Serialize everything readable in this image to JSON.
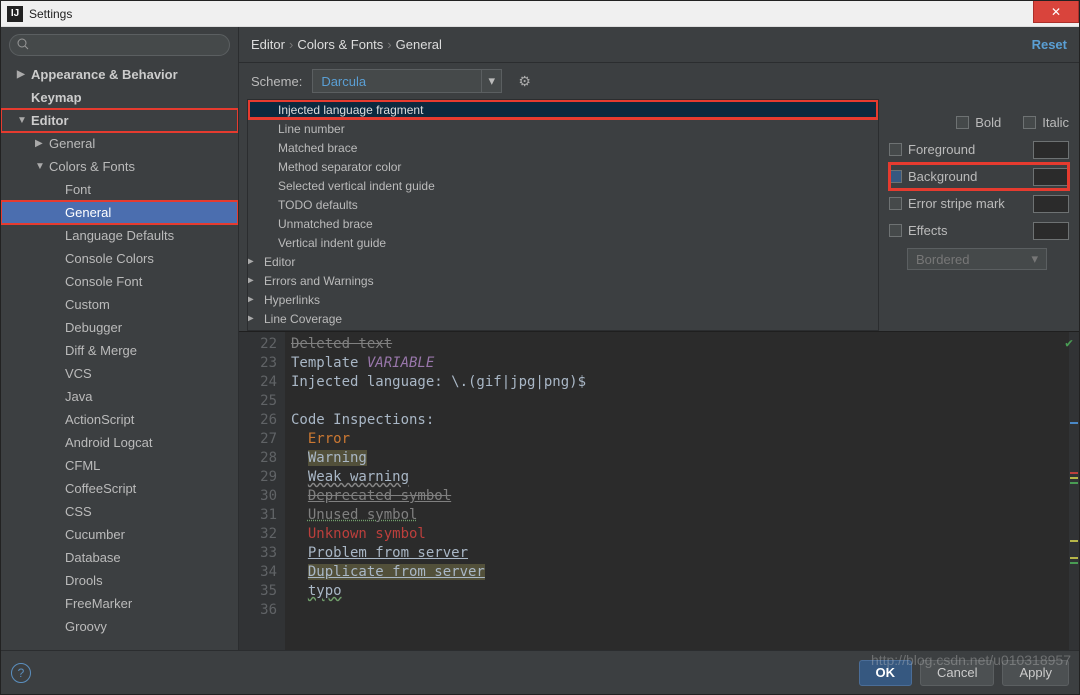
{
  "window": {
    "title": "Settings",
    "close": "✕"
  },
  "search": {
    "placeholder": ""
  },
  "sidebar": {
    "items": [
      {
        "label": "Appearance & Behavior",
        "arrow": "▶",
        "bold": true,
        "lvl": 0
      },
      {
        "label": "Keymap",
        "arrow": "",
        "bold": true,
        "lvl": 0,
        "pad": true
      },
      {
        "label": "Editor",
        "arrow": "▼",
        "bold": true,
        "lvl": 0,
        "red": true
      },
      {
        "label": "General",
        "arrow": "▶",
        "bold": false,
        "lvl": 1
      },
      {
        "label": "Colors & Fonts",
        "arrow": "▼",
        "bold": false,
        "lvl": 1
      },
      {
        "label": "Font",
        "arrow": "",
        "bold": false,
        "lvl": 2,
        "pad": true
      },
      {
        "label": "General",
        "arrow": "",
        "bold": false,
        "lvl": 2,
        "pad": true,
        "sel": true,
        "red": true
      },
      {
        "label": "Language Defaults",
        "arrow": "",
        "bold": false,
        "lvl": 2,
        "pad": true
      },
      {
        "label": "Console Colors",
        "arrow": "",
        "bold": false,
        "lvl": 2,
        "pad": true
      },
      {
        "label": "Console Font",
        "arrow": "",
        "bold": false,
        "lvl": 2,
        "pad": true
      },
      {
        "label": "Custom",
        "arrow": "",
        "bold": false,
        "lvl": 2,
        "pad": true
      },
      {
        "label": "Debugger",
        "arrow": "",
        "bold": false,
        "lvl": 2,
        "pad": true
      },
      {
        "label": "Diff & Merge",
        "arrow": "",
        "bold": false,
        "lvl": 2,
        "pad": true
      },
      {
        "label": "VCS",
        "arrow": "",
        "bold": false,
        "lvl": 2,
        "pad": true
      },
      {
        "label": "Java",
        "arrow": "",
        "bold": false,
        "lvl": 2,
        "pad": true
      },
      {
        "label": "ActionScript",
        "arrow": "",
        "bold": false,
        "lvl": 2,
        "pad": true
      },
      {
        "label": "Android Logcat",
        "arrow": "",
        "bold": false,
        "lvl": 2,
        "pad": true
      },
      {
        "label": "CFML",
        "arrow": "",
        "bold": false,
        "lvl": 2,
        "pad": true
      },
      {
        "label": "CoffeeScript",
        "arrow": "",
        "bold": false,
        "lvl": 2,
        "pad": true
      },
      {
        "label": "CSS",
        "arrow": "",
        "bold": false,
        "lvl": 2,
        "pad": true
      },
      {
        "label": "Cucumber",
        "arrow": "",
        "bold": false,
        "lvl": 2,
        "pad": true
      },
      {
        "label": "Database",
        "arrow": "",
        "bold": false,
        "lvl": 2,
        "pad": true
      },
      {
        "label": "Drools",
        "arrow": "",
        "bold": false,
        "lvl": 2,
        "pad": true
      },
      {
        "label": "FreeMarker",
        "arrow": "",
        "bold": false,
        "lvl": 2,
        "pad": true
      },
      {
        "label": "Groovy",
        "arrow": "",
        "bold": false,
        "lvl": 2,
        "pad": true
      }
    ]
  },
  "breadcrumb": {
    "p1": "Editor",
    "p2": "Colors & Fonts",
    "p3": "General",
    "reset": "Reset"
  },
  "scheme": {
    "label": "Scheme:",
    "value": "Darcula"
  },
  "attrlist": [
    {
      "label": "Injected language fragment",
      "lvl": 1,
      "sel": true,
      "red": true
    },
    {
      "label": "Line number",
      "lvl": 1
    },
    {
      "label": "Matched brace",
      "lvl": 1
    },
    {
      "label": "Method separator color",
      "lvl": 1
    },
    {
      "label": "Selected vertical indent guide",
      "lvl": 1
    },
    {
      "label": "TODO defaults",
      "lvl": 1
    },
    {
      "label": "Unmatched brace",
      "lvl": 1
    },
    {
      "label": "Vertical indent guide",
      "lvl": 1
    },
    {
      "label": "Editor",
      "lvl": 0,
      "arrow": "▶"
    },
    {
      "label": "Errors and Warnings",
      "lvl": 0,
      "arrow": "▶"
    },
    {
      "label": "Hyperlinks",
      "lvl": 0,
      "arrow": "▶"
    },
    {
      "label": "Line Coverage",
      "lvl": 0,
      "arrow": "▶"
    }
  ],
  "props": {
    "bold": "Bold",
    "italic": "Italic",
    "fg": "Foreground",
    "bg": "Background",
    "stripe": "Error stripe mark",
    "effects": "Effects",
    "effects_dd": "Bordered"
  },
  "preview": {
    "lines": [
      {
        "n": 22,
        "html": "<span class='strike'>Deleted text</span>"
      },
      {
        "n": 23,
        "html": "Template <span class='var'>VARIABLE</span>"
      },
      {
        "n": 24,
        "html": "Injected language: \\.(gif|jpg|png)$"
      },
      {
        "n": 25,
        "html": ""
      },
      {
        "n": 26,
        "html": "Code Inspections:"
      },
      {
        "n": 27,
        "html": "&nbsp;&nbsp;<span class='err'>Error</span>"
      },
      {
        "n": 28,
        "html": "&nbsp;&nbsp;<span class='warn'>Warning</span>"
      },
      {
        "n": 29,
        "html": "&nbsp;&nbsp;<span class='weak'>Weak warning</span>"
      },
      {
        "n": 30,
        "html": "&nbsp;&nbsp;<span class='dep'>Deprecated symbol</span>"
      },
      {
        "n": 31,
        "html": "&nbsp;&nbsp;<span class='unu'>Unused symbol</span>"
      },
      {
        "n": 32,
        "html": "&nbsp;&nbsp;<span class='unk'>Unknown symbol</span>"
      },
      {
        "n": 33,
        "html": "&nbsp;&nbsp;<span class='srv'>Problem from server</span>"
      },
      {
        "n": 34,
        "html": "&nbsp;&nbsp;<span class='dup'>Duplicate from server</span>"
      },
      {
        "n": 35,
        "html": "&nbsp;&nbsp;<span class='typo'>typo</span>"
      },
      {
        "n": 36,
        "html": ""
      }
    ]
  },
  "footer": {
    "ok": "OK",
    "cancel": "Cancel",
    "apply": "Apply"
  },
  "watermark": "http://blog.csdn.net/u010318957"
}
